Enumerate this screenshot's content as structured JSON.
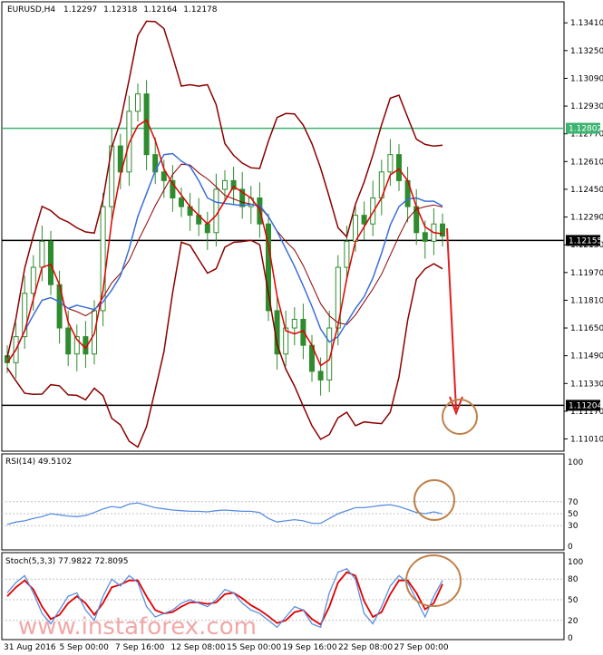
{
  "chart_data": [
    {
      "panel": "price",
      "type": "candlestick",
      "header": {
        "symbol": "EURUSD,H4",
        "open": "1.12297",
        "high": "1.12318",
        "low": "1.12164",
        "close": "1.12178"
      },
      "y_ticks": [
        "1.13410",
        "1.13250",
        "1.13090",
        "1.12930",
        "1.12770",
        "1.12610",
        "1.12450",
        "1.12290",
        "1.12130",
        "1.11970",
        "1.11810",
        "1.11650",
        "1.11490",
        "1.11330",
        "1.11170",
        "1.11010"
      ],
      "ylim": [
        1.1095,
        1.135
      ],
      "levels": [
        {
          "label": "1.12802",
          "value": 1.12802,
          "color": "#3cb371"
        },
        {
          "label": "1.12155",
          "value": 1.12155,
          "color": "#000000"
        },
        {
          "label": "1.11204",
          "value": 1.11204,
          "color": "#000000"
        }
      ],
      "x_labels": [
        "31 Aug 2016",
        "5 Sep 00:00",
        "7 Sep 16:00",
        "12 Sep 08:00",
        "15 Sep 00:00",
        "19 Sep 16:00",
        "22 Sep 08:00",
        "27 Sep 00:00"
      ],
      "close": [
        1.1145,
        1.116,
        1.1185,
        1.12,
        1.1215,
        1.119,
        1.1165,
        1.115,
        1.116,
        1.115,
        1.1175,
        1.1235,
        1.127,
        1.1255,
        1.129,
        1.13,
        1.1265,
        1.1255,
        1.125,
        1.124,
        1.1235,
        1.123,
        1.1225,
        1.122,
        1.1245,
        1.125,
        1.1245,
        1.1235,
        1.124,
        1.1225,
        1.1175,
        1.115,
        1.1165,
        1.117,
        1.1155,
        1.114,
        1.1135,
        1.1165,
        1.12,
        1.1215,
        1.123,
        1.1225,
        1.124,
        1.1255,
        1.1265,
        1.125,
        1.1235,
        1.122,
        1.1215,
        1.1225,
        1.1218
      ],
      "colors": {
        "candle": "#2e8b2e",
        "ma_fast": "#e00000",
        "ma_slow": "#3a6fd8",
        "bands": "#8b0000",
        "arrow": "#e02020",
        "circle": "#c0804a"
      }
    },
    {
      "panel": "rsi",
      "type": "line",
      "label": "RSI(14) 49.5102",
      "y_ticks": [
        "100",
        "70",
        "50",
        "30",
        "0"
      ],
      "ylim": [
        0,
        100
      ],
      "levels": [
        70,
        50,
        30
      ],
      "values": [
        32,
        36,
        38,
        42,
        45,
        50,
        48,
        46,
        45,
        47,
        52,
        58,
        62,
        60,
        66,
        68,
        64,
        60,
        58,
        56,
        55,
        54,
        54,
        53,
        55,
        56,
        55,
        54,
        54,
        52,
        42,
        36,
        38,
        40,
        38,
        34,
        34,
        42,
        50,
        55,
        60,
        60,
        62,
        64,
        65,
        62,
        57,
        52,
        50,
        53,
        49.5
      ]
    },
    {
      "panel": "stochastic",
      "type": "line",
      "label": "Stoch(5,3,3) 77.9822 72.8095",
      "y_ticks": [
        "100",
        "80",
        "50",
        "20",
        "0"
      ],
      "ylim": [
        0,
        100
      ],
      "levels": [
        80,
        50,
        20
      ],
      "main": [
        60,
        75,
        85,
        60,
        30,
        15,
        35,
        55,
        60,
        35,
        20,
        55,
        80,
        70,
        85,
        75,
        40,
        25,
        30,
        35,
        45,
        50,
        45,
        40,
        50,
        65,
        60,
        45,
        35,
        30,
        20,
        10,
        25,
        40,
        35,
        15,
        10,
        60,
        90,
        95,
        80,
        30,
        15,
        40,
        70,
        85,
        75,
        50,
        25,
        55,
        78
      ],
      "signal": [
        55,
        68,
        78,
        65,
        40,
        22,
        28,
        45,
        55,
        45,
        28,
        45,
        68,
        72,
        78,
        78,
        55,
        35,
        30,
        32,
        40,
        46,
        46,
        44,
        46,
        58,
        60,
        52,
        42,
        35,
        26,
        16,
        20,
        32,
        35,
        22,
        14,
        40,
        75,
        90,
        85,
        48,
        25,
        32,
        58,
        78,
        78,
        60,
        36,
        45,
        72.8
      ]
    }
  ],
  "watermark": "www.instaforex.com"
}
